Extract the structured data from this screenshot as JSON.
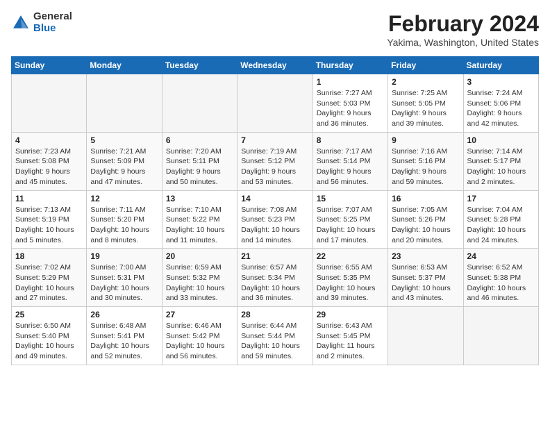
{
  "header": {
    "logo": {
      "general": "General",
      "blue": "Blue"
    },
    "title": "February 2024",
    "location": "Yakima, Washington, United States"
  },
  "weekdays": [
    "Sunday",
    "Monday",
    "Tuesday",
    "Wednesday",
    "Thursday",
    "Friday",
    "Saturday"
  ],
  "weeks": [
    [
      {
        "day": "",
        "empty": true
      },
      {
        "day": "",
        "empty": true
      },
      {
        "day": "",
        "empty": true
      },
      {
        "day": "",
        "empty": true
      },
      {
        "day": "1",
        "sunrise": "7:27 AM",
        "sunset": "5:03 PM",
        "daylight": "9 hours and 36 minutes."
      },
      {
        "day": "2",
        "sunrise": "7:25 AM",
        "sunset": "5:05 PM",
        "daylight": "9 hours and 39 minutes."
      },
      {
        "day": "3",
        "sunrise": "7:24 AM",
        "sunset": "5:06 PM",
        "daylight": "9 hours and 42 minutes."
      }
    ],
    [
      {
        "day": "4",
        "sunrise": "7:23 AM",
        "sunset": "5:08 PM",
        "daylight": "9 hours and 45 minutes."
      },
      {
        "day": "5",
        "sunrise": "7:21 AM",
        "sunset": "5:09 PM",
        "daylight": "9 hours and 47 minutes."
      },
      {
        "day": "6",
        "sunrise": "7:20 AM",
        "sunset": "5:11 PM",
        "daylight": "9 hours and 50 minutes."
      },
      {
        "day": "7",
        "sunrise": "7:19 AM",
        "sunset": "5:12 PM",
        "daylight": "9 hours and 53 minutes."
      },
      {
        "day": "8",
        "sunrise": "7:17 AM",
        "sunset": "5:14 PM",
        "daylight": "9 hours and 56 minutes."
      },
      {
        "day": "9",
        "sunrise": "7:16 AM",
        "sunset": "5:16 PM",
        "daylight": "9 hours and 59 minutes."
      },
      {
        "day": "10",
        "sunrise": "7:14 AM",
        "sunset": "5:17 PM",
        "daylight": "10 hours and 2 minutes."
      }
    ],
    [
      {
        "day": "11",
        "sunrise": "7:13 AM",
        "sunset": "5:19 PM",
        "daylight": "10 hours and 5 minutes."
      },
      {
        "day": "12",
        "sunrise": "7:11 AM",
        "sunset": "5:20 PM",
        "daylight": "10 hours and 8 minutes."
      },
      {
        "day": "13",
        "sunrise": "7:10 AM",
        "sunset": "5:22 PM",
        "daylight": "10 hours and 11 minutes."
      },
      {
        "day": "14",
        "sunrise": "7:08 AM",
        "sunset": "5:23 PM",
        "daylight": "10 hours and 14 minutes."
      },
      {
        "day": "15",
        "sunrise": "7:07 AM",
        "sunset": "5:25 PM",
        "daylight": "10 hours and 17 minutes."
      },
      {
        "day": "16",
        "sunrise": "7:05 AM",
        "sunset": "5:26 PM",
        "daylight": "10 hours and 20 minutes."
      },
      {
        "day": "17",
        "sunrise": "7:04 AM",
        "sunset": "5:28 PM",
        "daylight": "10 hours and 24 minutes."
      }
    ],
    [
      {
        "day": "18",
        "sunrise": "7:02 AM",
        "sunset": "5:29 PM",
        "daylight": "10 hours and 27 minutes."
      },
      {
        "day": "19",
        "sunrise": "7:00 AM",
        "sunset": "5:31 PM",
        "daylight": "10 hours and 30 minutes."
      },
      {
        "day": "20",
        "sunrise": "6:59 AM",
        "sunset": "5:32 PM",
        "daylight": "10 hours and 33 minutes."
      },
      {
        "day": "21",
        "sunrise": "6:57 AM",
        "sunset": "5:34 PM",
        "daylight": "10 hours and 36 minutes."
      },
      {
        "day": "22",
        "sunrise": "6:55 AM",
        "sunset": "5:35 PM",
        "daylight": "10 hours and 39 minutes."
      },
      {
        "day": "23",
        "sunrise": "6:53 AM",
        "sunset": "5:37 PM",
        "daylight": "10 hours and 43 minutes."
      },
      {
        "day": "24",
        "sunrise": "6:52 AM",
        "sunset": "5:38 PM",
        "daylight": "10 hours and 46 minutes."
      }
    ],
    [
      {
        "day": "25",
        "sunrise": "6:50 AM",
        "sunset": "5:40 PM",
        "daylight": "10 hours and 49 minutes."
      },
      {
        "day": "26",
        "sunrise": "6:48 AM",
        "sunset": "5:41 PM",
        "daylight": "10 hours and 52 minutes."
      },
      {
        "day": "27",
        "sunrise": "6:46 AM",
        "sunset": "5:42 PM",
        "daylight": "10 hours and 56 minutes."
      },
      {
        "day": "28",
        "sunrise": "6:44 AM",
        "sunset": "5:44 PM",
        "daylight": "10 hours and 59 minutes."
      },
      {
        "day": "29",
        "sunrise": "6:43 AM",
        "sunset": "5:45 PM",
        "daylight": "11 hours and 2 minutes."
      },
      {
        "day": "",
        "empty": true
      },
      {
        "day": "",
        "empty": true
      }
    ]
  ]
}
